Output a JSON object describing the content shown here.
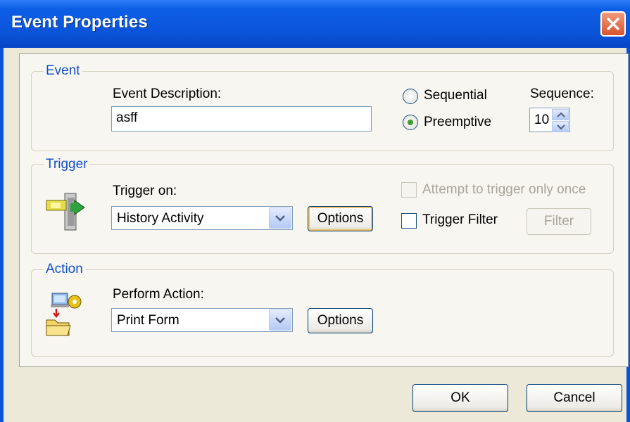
{
  "window": {
    "title": "Event Properties"
  },
  "event": {
    "group_label": "Event",
    "description_label": "Event Description:",
    "description_value": "asff",
    "mode_options": [
      "Sequential",
      "Preemptive"
    ],
    "selected_mode": "Preemptive",
    "sequence_label": "Sequence:",
    "sequence_value": "10"
  },
  "trigger": {
    "group_label": "Trigger",
    "trigger_on_label": "Trigger on:",
    "trigger_on_value": "History Activity",
    "options_button": "Options",
    "attempt_once_label": "Attempt to trigger only once",
    "attempt_once_checked": false,
    "attempt_once_enabled": false,
    "trigger_filter_label": "Trigger Filter",
    "trigger_filter_checked": false,
    "filter_button": "Filter",
    "filter_enabled": false
  },
  "action": {
    "group_label": "Action",
    "perform_action_label": "Perform Action:",
    "perform_action_value": "Print Form",
    "options_button": "Options"
  },
  "buttons": {
    "ok": "OK",
    "cancel": "Cancel"
  }
}
